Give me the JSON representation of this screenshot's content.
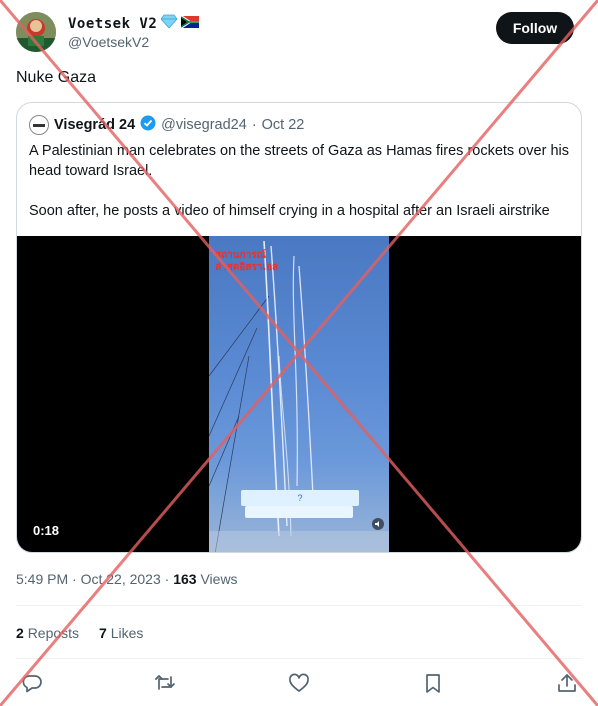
{
  "author": {
    "display_name": "Voetsek V2",
    "handle": "@VoetsekV2",
    "badges": [
      "diamond-emoji",
      "south-africa-flag-emoji"
    ]
  },
  "follow_label": "Follow",
  "tweet_text": "Nuke Gaza",
  "quote": {
    "name": "Visegrád 24",
    "handle": "@visegrad24",
    "separator": "·",
    "date": "Oct 22",
    "verified": true,
    "paragraph1": "A Palestinian man celebrates on the streets of Gaza as Hamas fires rockets over his head toward Israel.",
    "paragraph2": "Soon after, he posts a video of himself crying in a hospital after an Israeli airstrike",
    "video": {
      "duration": "0:18",
      "overlay_text_line1": "สถานการณ์",
      "overlay_text_line2": "ล่าสุดอิสราเอล",
      "caption_mark": "?"
    }
  },
  "meta": {
    "time": "5:49 PM",
    "separator": "·",
    "date": "Oct 22, 2023",
    "views_count": "163",
    "views_label": "Views"
  },
  "stats": {
    "reposts_count": "2",
    "reposts_label": "Reposts",
    "likes_count": "7",
    "likes_label": "Likes"
  },
  "colors": {
    "text_primary": "#0f1419",
    "text_secondary": "#536471",
    "verified_blue": "#1d9bf0",
    "cross_red": "#e46060",
    "follow_bg": "#0f1419"
  },
  "icons": [
    "reply-icon",
    "repost-icon",
    "like-icon",
    "bookmark-icon",
    "share-icon"
  ]
}
